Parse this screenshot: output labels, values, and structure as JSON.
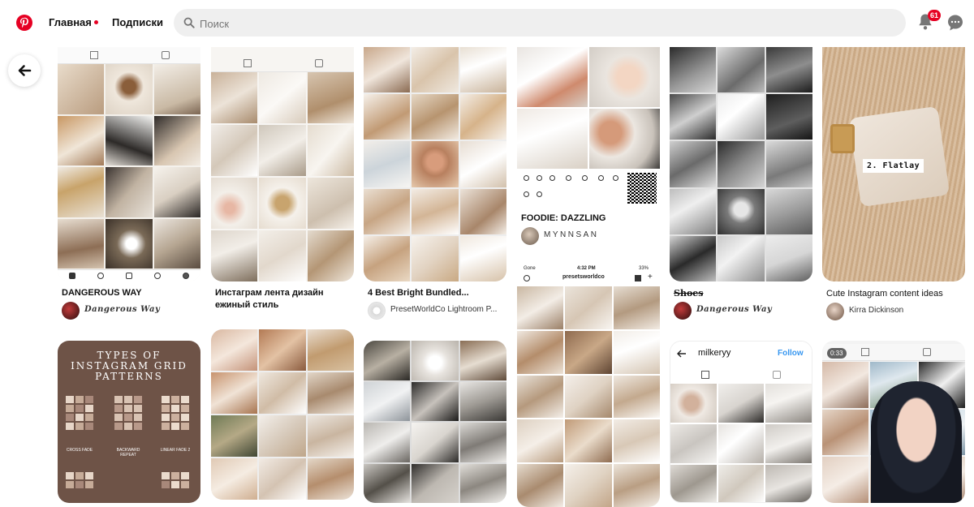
{
  "header": {
    "nav_home": "Главная",
    "nav_subscriptions": "Подписки",
    "search_placeholder": "Поиск",
    "notifications_count": "61"
  },
  "pins": [
    {
      "title": "DANGEROUS WAY",
      "user": "Dangerous Way"
    },
    {
      "title": "Инстаграм лента дизайн ежиный стиль",
      "user": ""
    },
    {
      "title": "4 Best Bright Bundled...",
      "user": "PresetWorldCo Lightroom P..."
    },
    {
      "title": "FOODIE: DAZZLING",
      "user": "MYNNSAN"
    },
    {
      "title": "Shoes",
      "user": "Dangerous Way"
    },
    {
      "title": "Cute Instagram content ideas",
      "user": "Kirra Dickinson",
      "overlay": "2. Flatlay"
    },
    {
      "overlay_title": "TYPES OF INSTAGRAM GRID PATTERNS",
      "swatch_labels": [
        "CROSS FADE",
        "BACKWARD REPEAT",
        "LINEAR FADE 2"
      ]
    },
    {
      "status_time": "4:32 PM",
      "status_battery": "33%",
      "status_carrier": "Gone",
      "profile": "presetsworldco"
    },
    {
      "profile": "milkeryy",
      "follow_label": "Follow"
    },
    {
      "time": "0:33"
    }
  ],
  "colors": {
    "brand": "#e60023",
    "search_bg": "#efefef",
    "follow": "#3897f0"
  }
}
